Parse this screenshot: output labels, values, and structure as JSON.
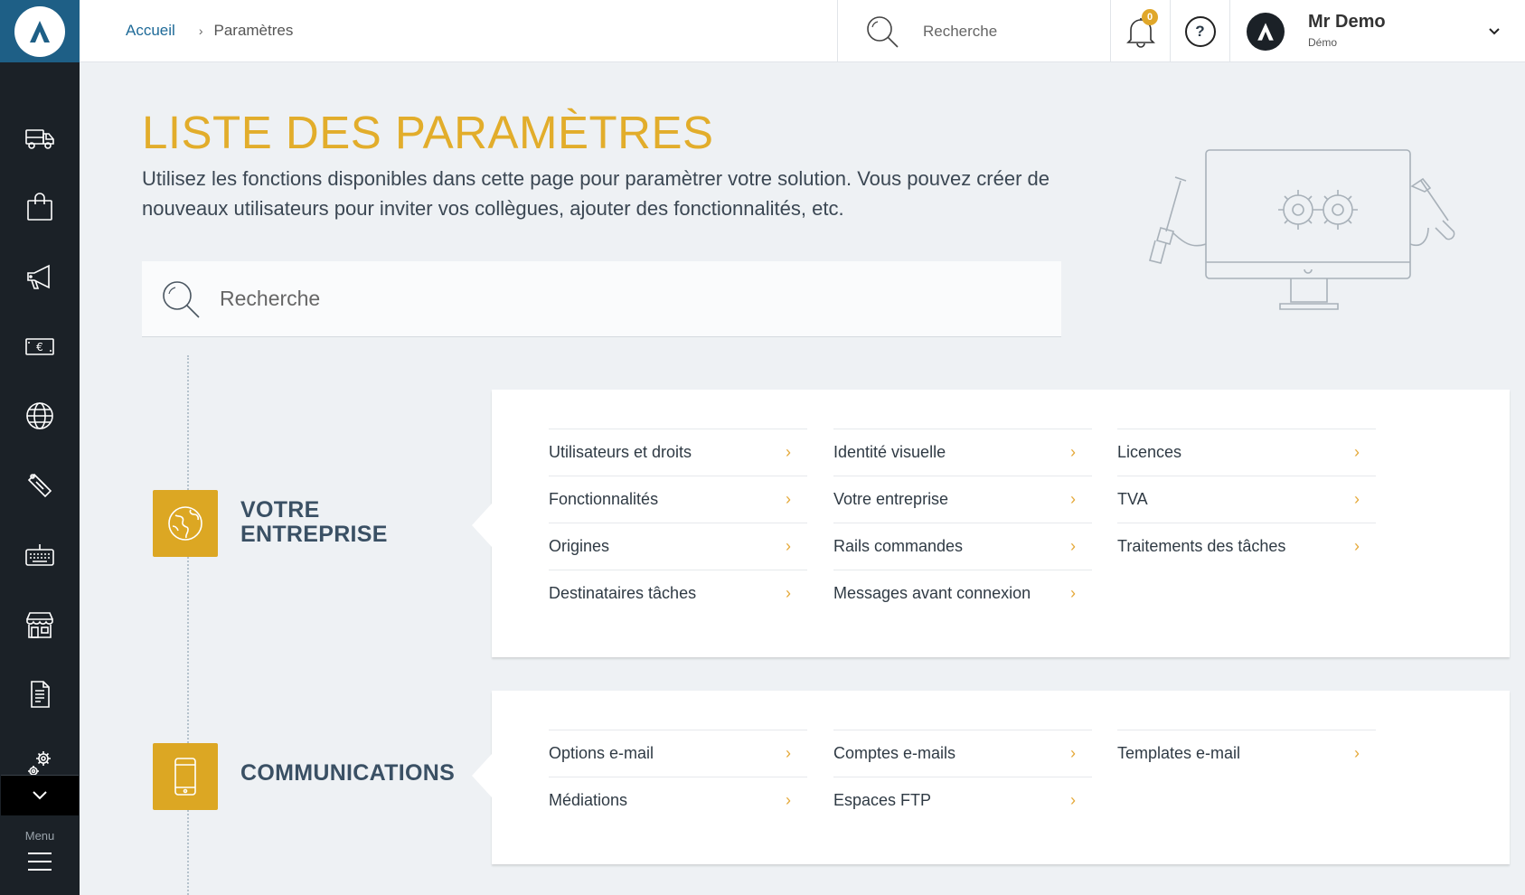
{
  "breadcrumb": {
    "home": "Accueil",
    "current": "Paramètres"
  },
  "topbar": {
    "search_placeholder": "Recherche",
    "notifications_count": "0",
    "help_label": "?",
    "user_name": "Mr Demo",
    "user_role": "Démo"
  },
  "sidebar": {
    "items": [
      {
        "icon": "truck-icon"
      },
      {
        "icon": "shopping-bag-icon"
      },
      {
        "icon": "megaphone-icon"
      },
      {
        "icon": "euro-banknote-icon"
      },
      {
        "icon": "globe-icon"
      },
      {
        "icon": "label-tag-icon"
      },
      {
        "icon": "keyboard-icon"
      },
      {
        "icon": "storefront-icon"
      },
      {
        "icon": "document-icon"
      },
      {
        "icon": "gears-icon"
      }
    ],
    "menu_label": "Menu"
  },
  "page": {
    "title": "LISTE DES PARAMÈTRES",
    "description": "Utilisez les fonctions disponibles dans cette page pour paramètrer votre solution. Vous pouvez créer de nouveaux utilisateurs pour inviter vos collègues, ajouter des fonctionnalités, etc.",
    "search_placeholder": "Recherche"
  },
  "sections": [
    {
      "title_line1": "VOTRE",
      "title_line2": "ENTREPRISE",
      "icon": "globe-icon",
      "columns": [
        [
          "Utilisateurs et droits",
          "Fonctionnalités",
          "Origines",
          "Destinataires tâches"
        ],
        [
          "Identité visuelle",
          "Votre entreprise",
          "Rails commandes",
          "Messages avant connexion"
        ],
        [
          "Licences",
          "TVA",
          "Traitements des tâches"
        ]
      ]
    },
    {
      "title_line1": "COMMUNICATIONS",
      "icon": "smartphone-icon",
      "columns": [
        [
          "Options e-mail",
          "Médiations"
        ],
        [
          "Comptes e-mails",
          "Espaces FTP"
        ],
        [
          "Templates e-mail"
        ]
      ]
    }
  ],
  "colors": {
    "accent": "#e2ad2b",
    "sidebar": "#1b2127",
    "brand": "#1e5f86"
  }
}
